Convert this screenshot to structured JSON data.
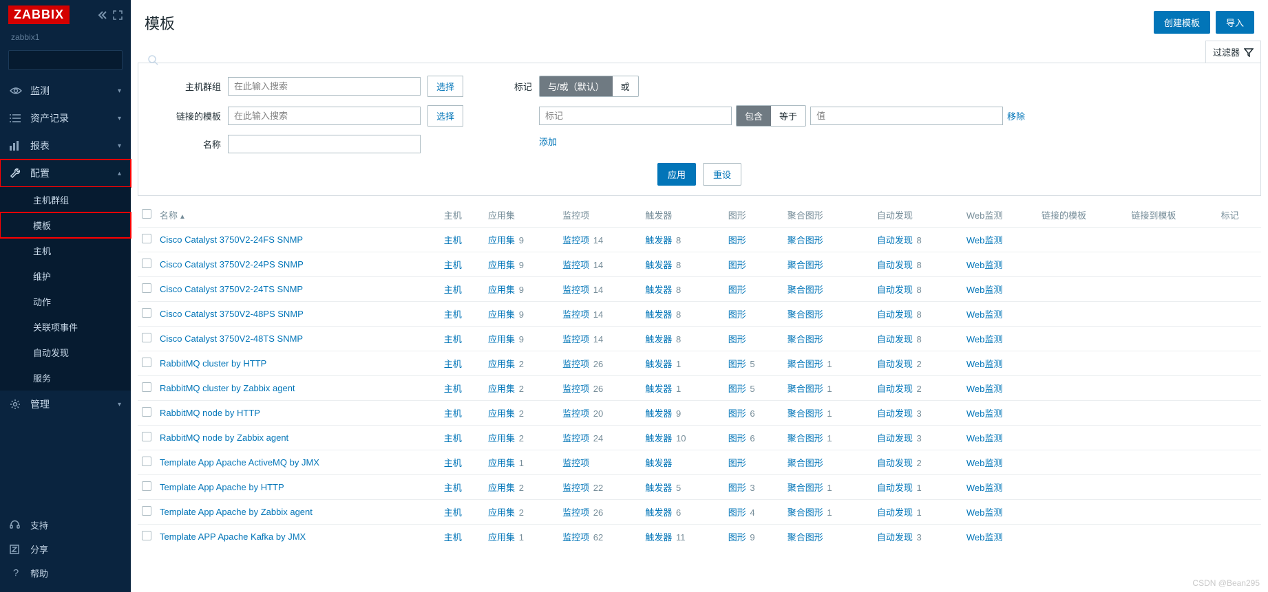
{
  "brand": "ZABBIX",
  "server_name": "zabbix1",
  "search": {
    "placeholder": ""
  },
  "nav": {
    "monitoring": "监测",
    "inventory": "资产记录",
    "reports": "报表",
    "configuration": "配置",
    "administration": "管理",
    "support": "支持",
    "share": "分享",
    "help": "帮助"
  },
  "config_sub": {
    "host_groups": "主机群组",
    "templates": "模板",
    "hosts": "主机",
    "maintenance": "维护",
    "actions": "动作",
    "correlation": "关联项事件",
    "discovery": "自动发现",
    "services": "服务"
  },
  "page": {
    "title": "模板",
    "create_btn": "创建模板",
    "import_btn": "导入"
  },
  "filter": {
    "tab_label": "过滤器",
    "host_groups_label": "主机群组",
    "linked_templates_label": "链接的模板",
    "name_label": "名称",
    "search_placeholder": "在此输入搜索",
    "select_btn": "选择",
    "tags_label": "标记",
    "andor_default": "与/或（默认）",
    "or": "或",
    "tag_placeholder": "标记",
    "contains": "包含",
    "equals": "等于",
    "value_placeholder": "值",
    "remove": "移除",
    "add": "添加",
    "apply": "应用",
    "reset": "重设"
  },
  "columns": {
    "name": "名称",
    "hosts": "主机",
    "applications": "应用集",
    "items": "监控项",
    "triggers": "触发器",
    "graphs": "图形",
    "screens": "聚合图形",
    "discovery": "自动发现",
    "web": "Web监测",
    "linked_templates": "链接的模板",
    "linked_to": "链接到模板",
    "tags": "标记"
  },
  "cell_labels": {
    "hosts": "主机",
    "applications": "应用集",
    "items": "监控项",
    "triggers": "触发器",
    "graphs": "图形",
    "screens": "聚合图形",
    "discovery": "自动发现",
    "web": "Web监测"
  },
  "rows": [
    {
      "name": "Cisco Catalyst 3750V2-24FS SNMP",
      "apps": 9,
      "items": 14,
      "triggers": 8,
      "graphs": "",
      "screens": "",
      "discovery": 8
    },
    {
      "name": "Cisco Catalyst 3750V2-24PS SNMP",
      "apps": 9,
      "items": 14,
      "triggers": 8,
      "graphs": "",
      "screens": "",
      "discovery": 8
    },
    {
      "name": "Cisco Catalyst 3750V2-24TS SNMP",
      "apps": 9,
      "items": 14,
      "triggers": 8,
      "graphs": "",
      "screens": "",
      "discovery": 8
    },
    {
      "name": "Cisco Catalyst 3750V2-48PS SNMP",
      "apps": 9,
      "items": 14,
      "triggers": 8,
      "graphs": "",
      "screens": "",
      "discovery": 8
    },
    {
      "name": "Cisco Catalyst 3750V2-48TS SNMP",
      "apps": 9,
      "items": 14,
      "triggers": 8,
      "graphs": "",
      "screens": "",
      "discovery": 8
    },
    {
      "name": "RabbitMQ cluster by HTTP",
      "apps": 2,
      "items": 26,
      "triggers": 1,
      "graphs": 5,
      "screens": 1,
      "discovery": 2
    },
    {
      "name": "RabbitMQ cluster by Zabbix agent",
      "apps": 2,
      "items": 26,
      "triggers": 1,
      "graphs": 5,
      "screens": 1,
      "discovery": 2
    },
    {
      "name": "RabbitMQ node by HTTP",
      "apps": 2,
      "items": 20,
      "triggers": 9,
      "graphs": 6,
      "screens": 1,
      "discovery": 3
    },
    {
      "name": "RabbitMQ node by Zabbix agent",
      "apps": 2,
      "items": 24,
      "triggers": 10,
      "graphs": 6,
      "screens": 1,
      "discovery": 3
    },
    {
      "name": "Template App Apache ActiveMQ by JMX",
      "apps": 1,
      "items": "",
      "triggers": "",
      "graphs": "",
      "screens": "",
      "discovery": 2
    },
    {
      "name": "Template App Apache by HTTP",
      "apps": 2,
      "items": 22,
      "triggers": 5,
      "graphs": 3,
      "screens": 1,
      "discovery": 1
    },
    {
      "name": "Template App Apache by Zabbix agent",
      "apps": 2,
      "items": 26,
      "triggers": 6,
      "graphs": 4,
      "screens": 1,
      "discovery": 1
    },
    {
      "name": "Template APP Apache Kafka by JMX",
      "apps": 1,
      "items": 62,
      "triggers": 11,
      "graphs": 9,
      "screens": "",
      "discovery": 3
    }
  ],
  "watermark": "CSDN @Bean295"
}
